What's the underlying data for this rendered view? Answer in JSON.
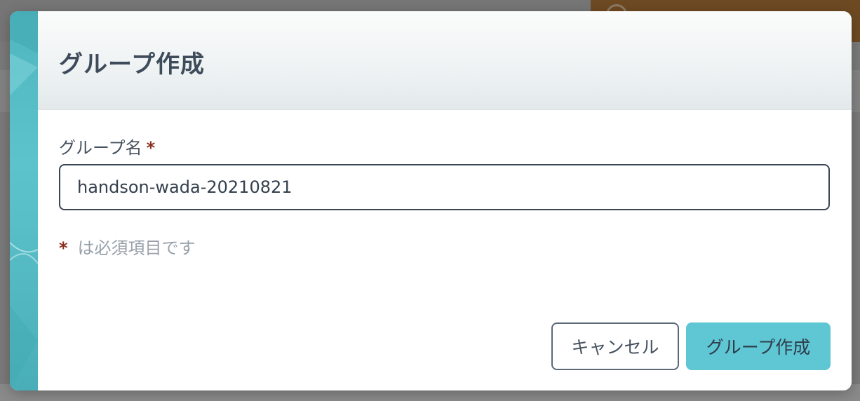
{
  "dialog": {
    "title": "グループ作成",
    "field_label": "グループ名",
    "required_mark": "*",
    "group_name_value": "handson-wada-20210821",
    "required_note_text": "は必須項目です",
    "cancel_label": "キャンセル",
    "create_label": "グループ作成"
  },
  "colors": {
    "accent": "#5ec7d3",
    "title_text": "#3e4b5b",
    "required_star": "#8b2e1f",
    "overlay": "#7a7a7a"
  }
}
